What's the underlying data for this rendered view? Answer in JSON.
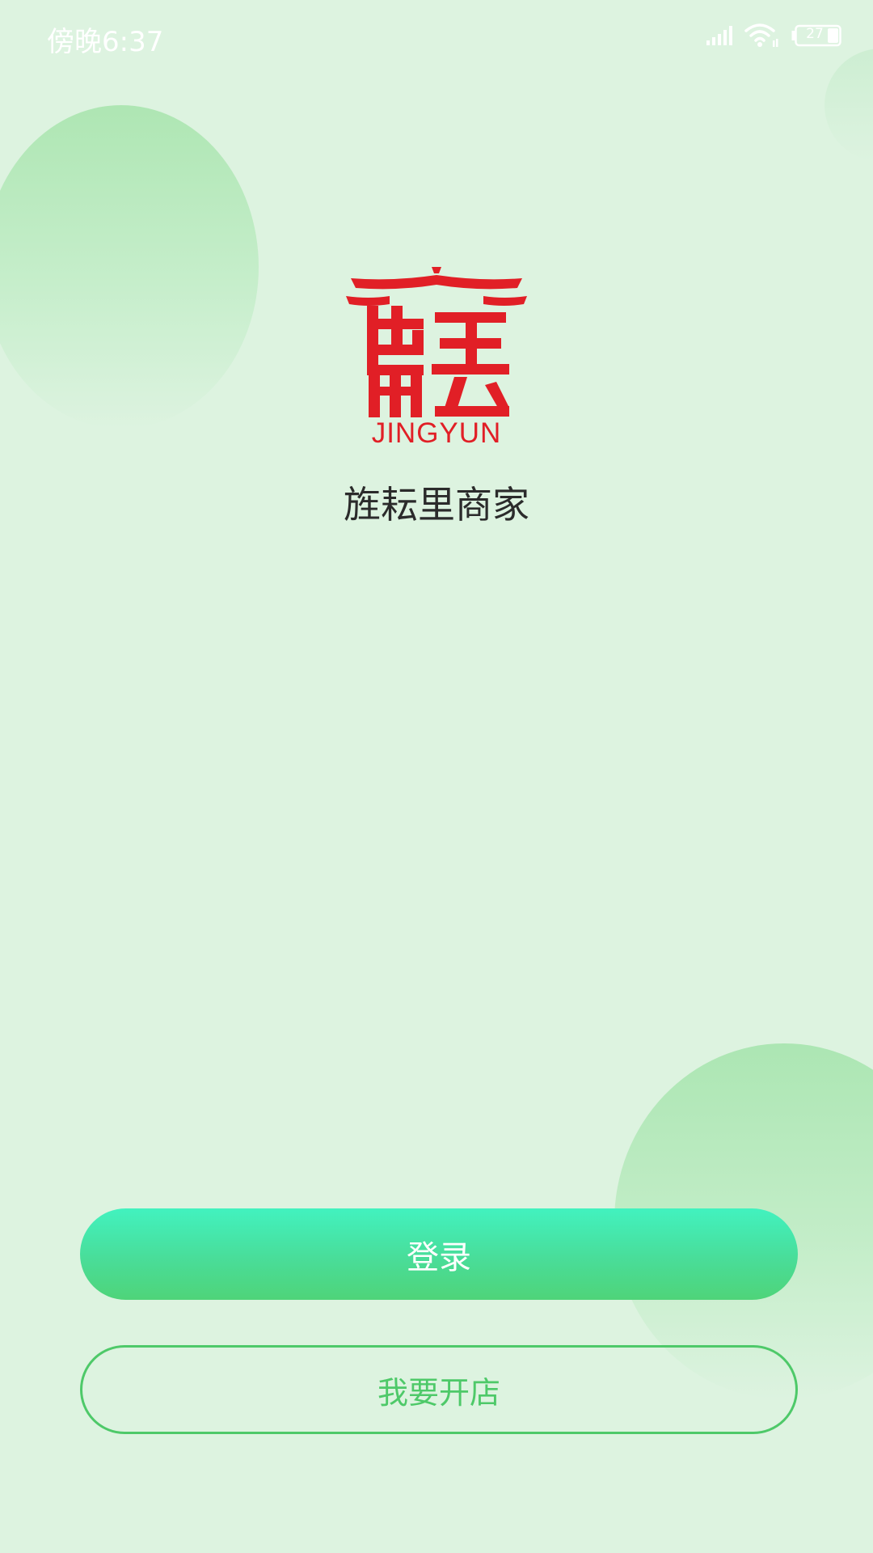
{
  "status_bar": {
    "time": "傍晚6:37",
    "battery_level": "27",
    "icons": [
      "signal-icon",
      "wifi-icon",
      "battery-icon"
    ]
  },
  "logo": {
    "wordmark": "JINGYUN",
    "color": "#e11f26"
  },
  "app_name": "旌耘里商家",
  "buttons": {
    "login_label": "登录",
    "open_store_label": "我要开店"
  },
  "colors": {
    "background": "#ddf3e0",
    "login_gradient_top": "#42f2bf",
    "login_gradient_bottom": "#4fd479",
    "outline_green": "#4ec969"
  }
}
